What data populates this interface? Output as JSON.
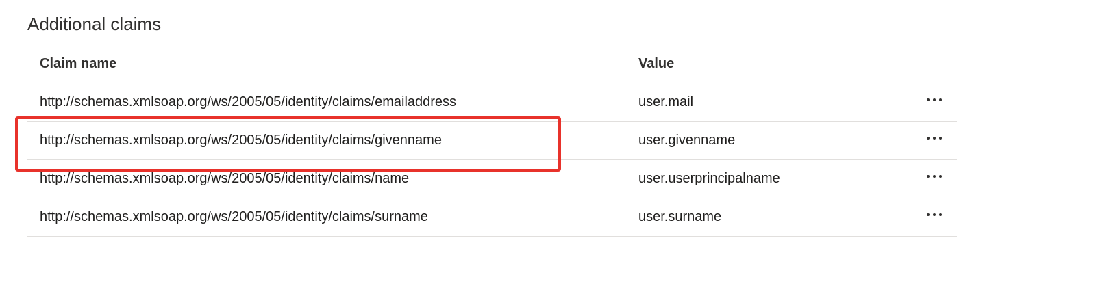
{
  "section": {
    "title": "Additional claims"
  },
  "table": {
    "columns": {
      "name": "Claim name",
      "value": "Value"
    },
    "rows": [
      {
        "name": "http://schemas.xmlsoap.org/ws/2005/05/identity/claims/emailaddress",
        "value": "user.mail",
        "highlighted": false
      },
      {
        "name": "http://schemas.xmlsoap.org/ws/2005/05/identity/claims/givenname",
        "value": "user.givenname",
        "highlighted": true
      },
      {
        "name": "http://schemas.xmlsoap.org/ws/2005/05/identity/claims/name",
        "value": "user.userprincipalname",
        "highlighted": false
      },
      {
        "name": "http://schemas.xmlsoap.org/ws/2005/05/identity/claims/surname",
        "value": "user.surname",
        "highlighted": false
      }
    ],
    "row_action_icon": "more-horizontal-icon"
  },
  "colors": {
    "highlight": "#e8322b",
    "divider": "#e1dfdd",
    "text": "#201f1e"
  }
}
